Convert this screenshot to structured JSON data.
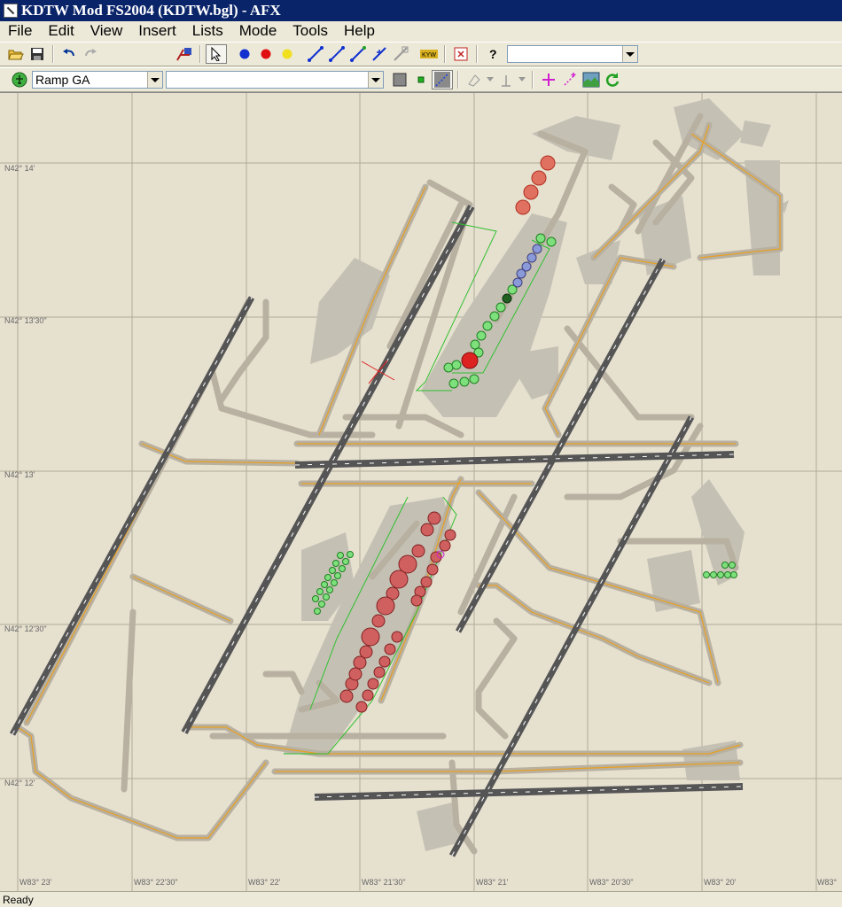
{
  "window": {
    "title": "KDTW Mod FS2004 (KDTW.bgl) - AFX"
  },
  "menu": [
    "File",
    "Edit",
    "View",
    "Insert",
    "Lists",
    "Mode",
    "Tools",
    "Help"
  ],
  "toolbar1": {
    "combo_value": ""
  },
  "toolbar2": {
    "parking_type": "Ramp GA",
    "name_combo": ""
  },
  "map": {
    "lat_labels": [
      "N42° 14'",
      "N42° 13'30\"",
      "N42° 13'",
      "N42° 12'30\"",
      "N42° 12'"
    ],
    "lon_labels": [
      "W83° 23'",
      "W83° 22'30\"",
      "W83° 22'",
      "W83° 21'30\"",
      "W83° 21'",
      "W83° 20'30\"",
      "W83° 20'",
      "W83°"
    ]
  },
  "status": {
    "text": "Ready"
  },
  "colors": {
    "titlebar": "#0a246a",
    "runway": "#555555",
    "taxiway": "#b8b0a0",
    "taxi_center": "#e8a020",
    "apron": "#c4c1b4",
    "parking_green": "#44cc44",
    "parking_red": "#dd4444"
  }
}
